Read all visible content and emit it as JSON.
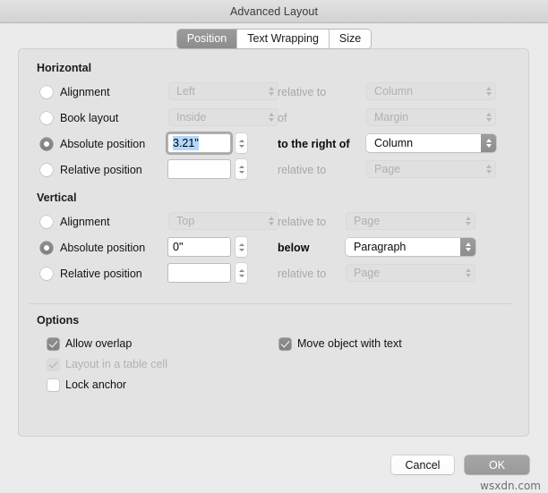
{
  "window": {
    "title": "Advanced Layout"
  },
  "tabs": [
    {
      "label": "Position",
      "active": true
    },
    {
      "label": "Text Wrapping",
      "active": false
    },
    {
      "label": "Size",
      "active": false
    }
  ],
  "horizontal": {
    "title": "Horizontal",
    "rows": [
      {
        "radio_label": "Alignment",
        "selected": false,
        "value_control": "popup",
        "value": "Left",
        "value_enabled": false,
        "mid_label": "relative to",
        "mid_strong": false,
        "target": "Column",
        "target_enabled": false
      },
      {
        "radio_label": "Book layout",
        "selected": false,
        "value_control": "popup",
        "value": "Inside",
        "value_enabled": false,
        "mid_label": "of",
        "mid_strong": false,
        "target": "Margin",
        "target_enabled": false
      },
      {
        "radio_label": "Absolute position",
        "selected": true,
        "value_control": "field",
        "value": "3.21\"",
        "value_enabled": true,
        "value_focused": true,
        "value_selected_text": true,
        "mid_label": "to the right of",
        "mid_strong": true,
        "target": "Column",
        "target_enabled": true
      },
      {
        "radio_label": "Relative position",
        "selected": false,
        "value_control": "field",
        "value": "",
        "value_enabled": true,
        "value_focused": false,
        "mid_label": "relative to",
        "mid_strong": false,
        "target": "Page",
        "target_enabled": false
      }
    ]
  },
  "vertical": {
    "title": "Vertical",
    "rows": [
      {
        "radio_label": "Alignment",
        "selected": false,
        "value_control": "popup",
        "value": "Top",
        "value_enabled": false,
        "mid_label": "relative to",
        "mid_strong": false,
        "target": "Page",
        "target_enabled": false
      },
      {
        "radio_label": "Absolute position",
        "selected": true,
        "value_control": "field",
        "value": "0\"",
        "value_enabled": true,
        "value_focused": false,
        "mid_label": "below",
        "mid_strong": true,
        "target": "Paragraph",
        "target_enabled": true
      },
      {
        "radio_label": "Relative position",
        "selected": false,
        "value_control": "field",
        "value": "",
        "value_enabled": true,
        "value_focused": false,
        "mid_label": "relative to",
        "mid_strong": false,
        "target": "Page",
        "target_enabled": false
      }
    ]
  },
  "options": {
    "title": "Options",
    "left": [
      {
        "label": "Allow overlap",
        "checked": true,
        "enabled": true
      },
      {
        "label": "Layout in a table cell",
        "checked": true,
        "enabled": false
      },
      {
        "label": "Lock anchor",
        "checked": false,
        "enabled": true
      }
    ],
    "right": [
      {
        "label": "Move object with text",
        "checked": true,
        "enabled": true
      }
    ]
  },
  "footer": {
    "cancel_label": "Cancel",
    "ok_label": "OK"
  },
  "watermark": "wsxdn.com"
}
